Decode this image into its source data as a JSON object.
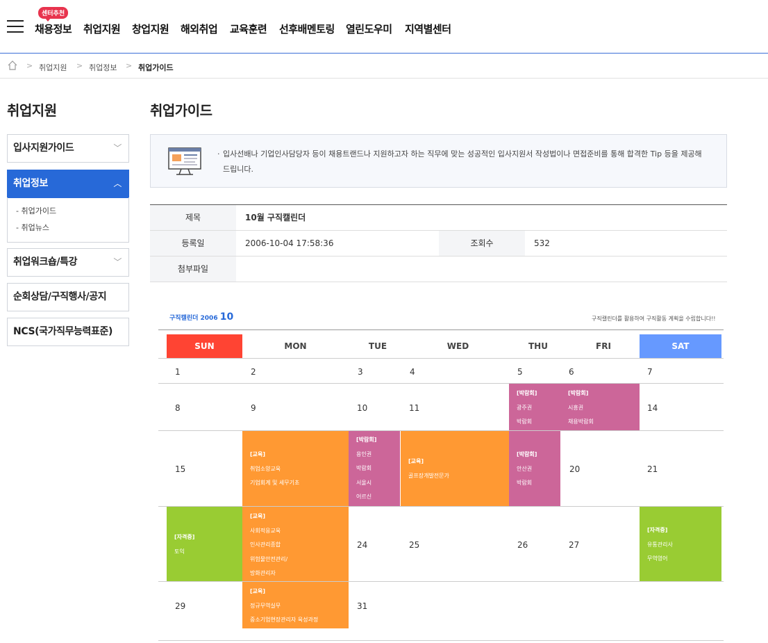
{
  "nav": {
    "badge": "센터추천",
    "items": [
      "채용정보",
      "취업지원",
      "창업지원",
      "해외취업",
      "교육훈련",
      "선후배멘토링",
      "열린도우미",
      "지역별센터"
    ]
  },
  "breadcrumb": [
    "취업지원",
    "취업정보",
    "취업가이드"
  ],
  "sidebar": {
    "title": "취업지원",
    "menu": [
      "입사지원가이드",
      "취업정보",
      "취업워크숍/특강",
      "순회상담/구직행사/공지",
      "NCS(국가직무능력표준)"
    ],
    "sub_items": [
      "- 취업가이드",
      "- 취업뉴스"
    ]
  },
  "main": {
    "title": "취업가이드",
    "info": "입사선배나 기업인사담당자 등이 채용트랜드나 지원하고자 하는 직무에 맞는 성공적인 입사지원서 작성법이나 면접준비를 통해 합격한 Tip 등을 제공해 드립니다.",
    "labels": {
      "subject": "제목",
      "date": "등록일",
      "views": "조회수",
      "attachment": "첨부파일"
    },
    "subject": "10월 구직캘린더",
    "date": "2006-10-04 17:58:36",
    "views": "532",
    "attachment": ""
  },
  "calendar": {
    "label": "구직캘린더 2006",
    "month": "10",
    "note": "구직캘린더를 활용하여 구직활동 계획을 수립합니다!!",
    "days": [
      "SUN",
      "MON",
      "TUE",
      "WED",
      "THU",
      "FRI",
      "SAT"
    ],
    "day_colors": {
      "sun": "#ff4433",
      "sat": "#6699ff"
    },
    "dates": [
      "1",
      "2",
      "3",
      "4",
      "5",
      "6",
      "7",
      "8",
      "9",
      "10",
      "11",
      "14",
      "15",
      "20",
      "21",
      "24",
      "25",
      "26",
      "27",
      "29",
      "31"
    ],
    "events": {
      "gwangju": [
        "[박람회]",
        "광주권",
        "박람회"
      ],
      "siheung": [
        "[박람회]",
        "시흥권",
        "채용박람회"
      ],
      "edu1": [
        "[교육]",
        "취업소양교육",
        "기업회계 및 세무기초"
      ],
      "yongin": [
        "[박람회]",
        "용인권",
        "박람회",
        "서울시",
        "어르신"
      ],
      "golf": [
        "[교육]",
        "골프장개발전문가"
      ],
      "ansan": [
        "[박람회]",
        "안산권",
        "박람회"
      ],
      "toeic": [
        "[자격증]",
        "토익"
      ],
      "edu2": [
        "[교육]",
        "사회적응교육",
        "인사관리종합",
        "위험물안전관리/",
        "방화관리자"
      ],
      "logistics": [
        "[자격증]",
        "유통관리사",
        "무역영어"
      ],
      "edu3": [
        "[교육]",
        "정규무역실무",
        "중소기업현장관리자 육성과정"
      ]
    }
  }
}
